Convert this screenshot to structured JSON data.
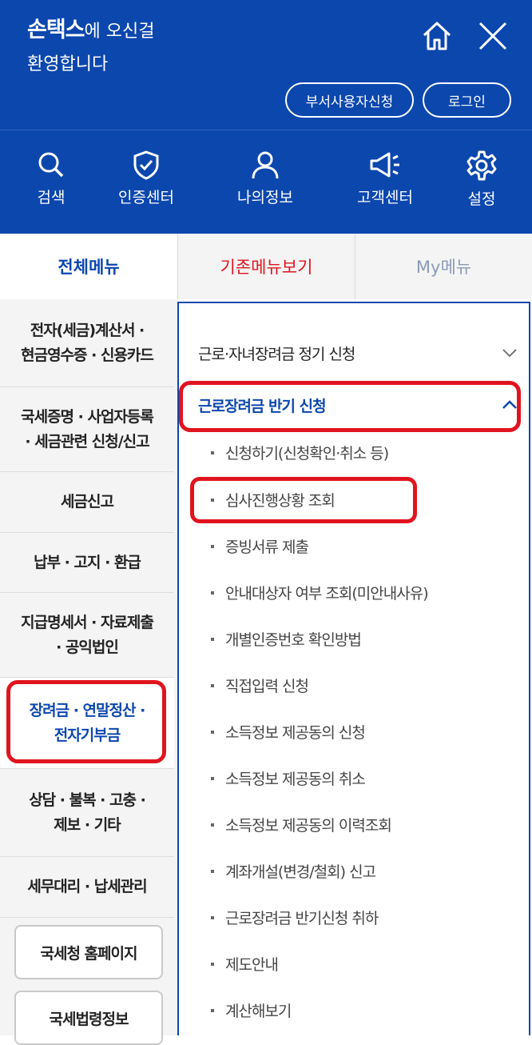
{
  "header": {
    "brand": "손택스",
    "welcome_suffix": "에 오신걸",
    "welcome_line2": "환영합니다",
    "buttons": {
      "dept_user": "부서사용자신청",
      "login": "로그인"
    },
    "quick_menu": [
      {
        "label": "검색",
        "icon": "search-icon"
      },
      {
        "label": "인증센터",
        "icon": "shield-check-icon"
      },
      {
        "label": "나의정보",
        "icon": "person-icon"
      },
      {
        "label": "고객센터",
        "icon": "megaphone-icon"
      },
      {
        "label": "설정",
        "icon": "gear-icon"
      }
    ]
  },
  "tabs": {
    "all_menu": "전체메뉴",
    "legacy_menu": "기존메뉴보기",
    "my_menu": "My메뉴"
  },
  "left_menu": [
    {
      "line1": "전자(세금)계산서 ·",
      "line2": "현금영수증 · 신용카드"
    },
    {
      "line1": "국세증명 · 사업자등록",
      "line2": "· 세금관련 신청/신고"
    },
    {
      "line1": "세금신고",
      "line2": ""
    },
    {
      "line1": "납부 · 고지 · 환급",
      "line2": ""
    },
    {
      "line1": "지급명세서 · 자료제출",
      "line2": "· 공익법인"
    },
    {
      "line1": "장려금 · 연말정산 ·",
      "line2": "전자기부금"
    },
    {
      "line1": "상담 · 불복 · 고충 ·",
      "line2": "제보 · 기타"
    },
    {
      "line1": "세무대리 · 납세관리",
      "line2": ""
    }
  ],
  "left_buttons": {
    "nts_home": "국세청 홈페이지",
    "law_info": "국세법령정보"
  },
  "right_menu": {
    "section_closed": "근로·자녀장려금 정기 신청",
    "section_open": "근로장려금 반기 신청",
    "items": [
      "신청하기(신청확인·취소 등)",
      "심사진행상황 조회",
      "증빙서류 제출",
      "안내대상자 여부 조회(미안내사유)",
      "개별인증번호 확인방법",
      "직접입력 신청",
      "소득정보 제공동의 신청",
      "소득정보 제공동의 취소",
      "소득정보 제공동의 이력조회",
      "계좌개설(변경/철회) 신고",
      "근로장려금 반기신청 취하",
      "제도안내",
      "계산해보기"
    ]
  },
  "colors": {
    "brand_blue": "#0c47ae",
    "highlight_red": "#e0141e"
  }
}
